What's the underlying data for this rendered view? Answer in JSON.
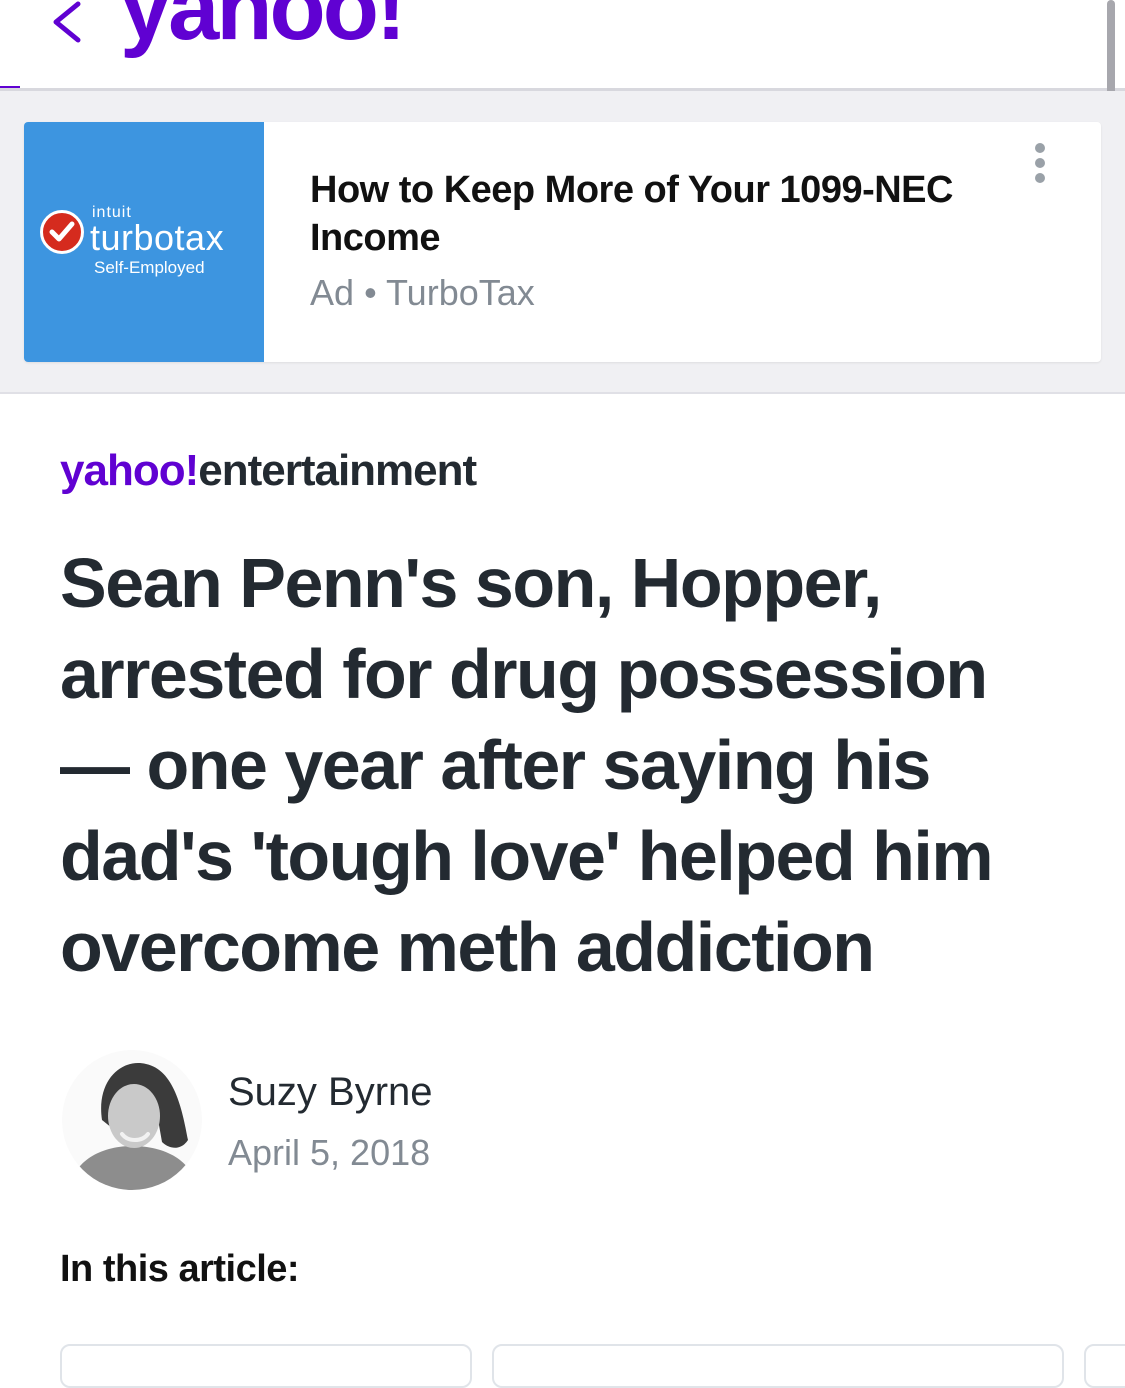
{
  "header": {
    "logo_text": "yahoo!",
    "brand_color": "#6001d2"
  },
  "ad": {
    "image": {
      "intuit": "intuit",
      "brand": "turbotax",
      "sub": "Self-Employed"
    },
    "title": "How to Keep More of Your 1099-NEC Income",
    "label": "Ad",
    "separator": "•",
    "sponsor": "TurboTax"
  },
  "article": {
    "provider_brand": "yahoo!",
    "provider_section": "entertainment",
    "headline": "Sean Penn's son, Hopper, arrested for drug possession — one year after saying his dad's 'tough love' helped him overcome meth addiction",
    "author": "Suzy Byrne",
    "date": "April 5, 2018",
    "in_this_article": "In this article:"
  }
}
